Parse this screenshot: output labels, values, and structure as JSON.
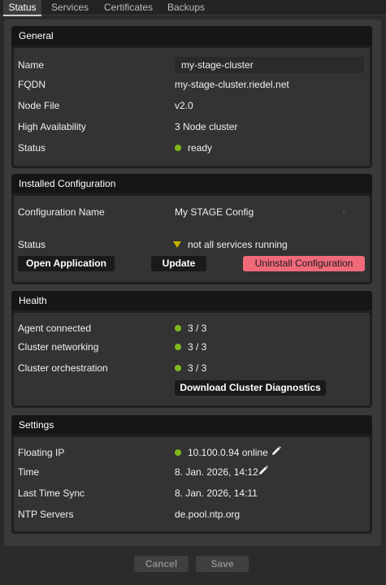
{
  "tabs": [
    {
      "label": "Status"
    },
    {
      "label": "Services"
    },
    {
      "label": "Certificates"
    },
    {
      "label": "Backups"
    }
  ],
  "general": {
    "title": "General",
    "name_label": "Name",
    "name_value": "my-stage-cluster",
    "fqdn_label": "FQDN",
    "fqdn_value": "my-stage-cluster.riedel.net",
    "node_file_label": "Node File",
    "node_file_value": "v2.0",
    "ha_label": "High Availability",
    "ha_value": "3 Node cluster",
    "status_label": "Status",
    "status_value": "ready"
  },
  "installed": {
    "title": "Installed Configuration",
    "config_name_label": "Configuration Name",
    "config_name_value": "My STAGE Config",
    "status_label": "Status",
    "status_value": "not all services running",
    "open_app_label": "Open Application",
    "update_label": "Update",
    "uninstall_label": "Uninstall Configuration"
  },
  "health": {
    "title": "Health",
    "agent_label": "Agent connected",
    "agent_value": "3 / 3",
    "networking_label": "Cluster networking",
    "networking_value": "3 / 3",
    "orchestration_label": "Cluster orchestration",
    "orchestration_value": "3 / 3",
    "diagnostics_label": "Download Cluster Diagnostics"
  },
  "settings": {
    "title": "Settings",
    "floating_ip_label": "Floating IP",
    "floating_ip_value": "10.100.0.94 online",
    "time_label": "Time",
    "time_value": "8. Jan. 2026, 14:12",
    "last_sync_label": "Last Time Sync",
    "last_sync_value": "8. Jan. 2026, 14:11",
    "ntp_label": "NTP Servers",
    "ntp_value": "de.pool.ntp.org"
  },
  "footer": {
    "cancel_label": "Cancel",
    "save_label": "Save"
  },
  "icons": {
    "status_ok": "green-dot-icon",
    "status_warning": "warning-triangle-icon",
    "edit": "pencil-icon",
    "chevron": "chevron-right-icon"
  },
  "colors": {
    "ok": "#7fb81e",
    "warning": "#c9b400",
    "danger": "#f06a7a"
  }
}
